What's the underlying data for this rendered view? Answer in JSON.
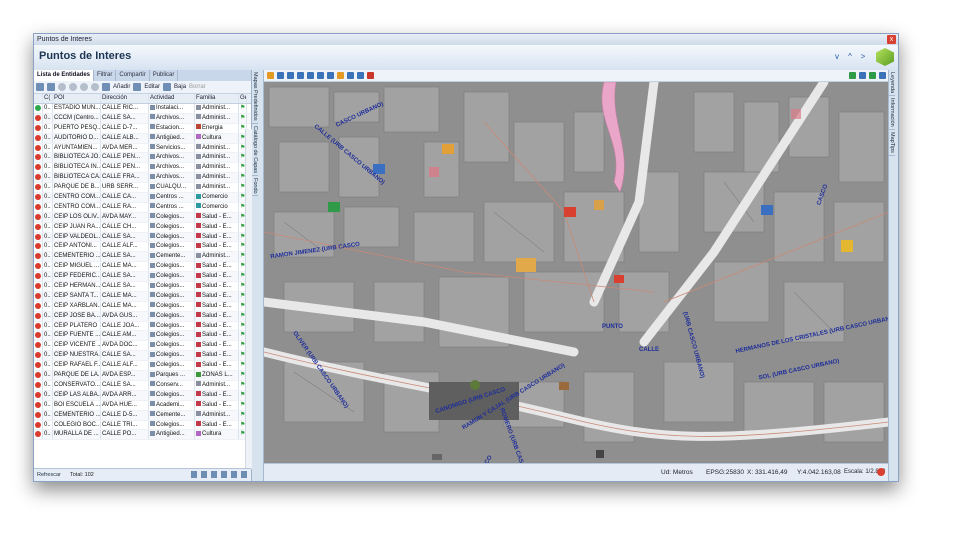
{
  "window": {
    "title": "Puntos de Interes",
    "header_title": "Puntos de Interes",
    "close": "x"
  },
  "header_buttons": [
    "v",
    "^",
    ">"
  ],
  "left_tabs": [
    "Lista de Entidades",
    "Filtrar",
    "Compartir",
    "Publicar"
  ],
  "left_toolbar": {
    "add": "Añadir",
    "edit": "Editar",
    "remove": "Baja",
    "delete": "Borrar"
  },
  "columns": {
    "c": "C(",
    "poi": "POI",
    "dir": "Dirección",
    "act": "Actividad",
    "fam": "Familia",
    "ge": "Ge"
  },
  "rows": [
    {
      "c": "0..",
      "poi": "ESTADIO MUN...",
      "dir": "CALLE RIC...",
      "act": "Instalaci...",
      "fam": "Administ...",
      "status": "green"
    },
    {
      "c": "0..",
      "poi": "CCCM (Centro...",
      "dir": "CALLE SA...",
      "act": "Archivos...",
      "fam": "Administ...",
      "status": "red"
    },
    {
      "c": "0..",
      "poi": "PUERTO PESQ...",
      "dir": "CALLE D-7...",
      "act": "Estacion...",
      "fam": "Energia",
      "status": "red"
    },
    {
      "c": "0..",
      "poi": "AUDITORIO D...",
      "dir": "CALLE ALB...",
      "act": "Antigüed...",
      "fam": "Cultura",
      "status": "red"
    },
    {
      "c": "0..",
      "poi": "AYUNTAMIEN...",
      "dir": "AVDA MER...",
      "act": "Servicios...",
      "fam": "Administ...",
      "status": "red"
    },
    {
      "c": "0..",
      "poi": "BIBLIOTECA JO...",
      "dir": "CALLE PEÑ...",
      "act": "Archivos...",
      "fam": "Administ...",
      "status": "red"
    },
    {
      "c": "0..",
      "poi": "BIBLIOTECA IN...",
      "dir": "CALLE PEÑ...",
      "act": "Archivos...",
      "fam": "Administ...",
      "status": "red"
    },
    {
      "c": "0..",
      "poi": "BIBLIOTECA CA...",
      "dir": "CALLE FRA...",
      "act": "Archivos...",
      "fam": "Administ...",
      "status": "red"
    },
    {
      "c": "0..",
      "poi": "PARQUE DE B...",
      "dir": "URB SERR...",
      "act": "CUALQU...",
      "fam": "Administ...",
      "status": "red"
    },
    {
      "c": "0..",
      "poi": "CENTRO COM...",
      "dir": "CALLE CA...",
      "act": "Centros ...",
      "fam": "Comercio",
      "status": "red"
    },
    {
      "c": "0..",
      "poi": "CENTRO COM...",
      "dir": "CALLE RA...",
      "act": "Centros ...",
      "fam": "Comercio",
      "status": "red"
    },
    {
      "c": "0..",
      "poi": "CEIP LOS OLIV...",
      "dir": "AVDA MAY...",
      "act": "Colegios...",
      "fam": "Salud - E...",
      "status": "red"
    },
    {
      "c": "0..",
      "poi": "CEIP JUAN RA...",
      "dir": "CALLE CH...",
      "act": "Colegios...",
      "fam": "Salud - E...",
      "status": "red"
    },
    {
      "c": "0..",
      "poi": "CEIP VALDEOL...",
      "dir": "CALLE SA...",
      "act": "Colegios...",
      "fam": "Salud - E...",
      "status": "red"
    },
    {
      "c": "0..",
      "poi": "CEIP ANTONI...",
      "dir": "CALLE ALF...",
      "act": "Colegios...",
      "fam": "Salud - E...",
      "status": "red"
    },
    {
      "c": "0..",
      "poi": "CEMENTERIO ...",
      "dir": "CALLE SA...",
      "act": "Cemente...",
      "fam": "Administ...",
      "status": "red"
    },
    {
      "c": "0..",
      "poi": "CEIP MIGUEL ...",
      "dir": "CALLE MA...",
      "act": "Colegios...",
      "fam": "Salud - E...",
      "status": "red"
    },
    {
      "c": "0..",
      "poi": "CEIP FEDERIC...",
      "dir": "CALLE SA...",
      "act": "Colegios...",
      "fam": "Salud - E...",
      "status": "red"
    },
    {
      "c": "0..",
      "poi": "CEIP HERMAN...",
      "dir": "CALLE SA...",
      "act": "Colegios...",
      "fam": "Salud - E...",
      "status": "red"
    },
    {
      "c": "0..",
      "poi": "CEIP SANTA T...",
      "dir": "CALLE MA...",
      "act": "Colegios...",
      "fam": "Salud - E...",
      "status": "red"
    },
    {
      "c": "0..",
      "poi": "CEIP XARBLAN...",
      "dir": "CALLE MA...",
      "act": "Colegios...",
      "fam": "Salud - E...",
      "status": "red"
    },
    {
      "c": "0..",
      "poi": "CEIP JOSE BA...",
      "dir": "AVDA GUS...",
      "act": "Colegios...",
      "fam": "Salud - E...",
      "status": "red"
    },
    {
      "c": "0..",
      "poi": "CEIP PLATERO",
      "dir": "CALLE JOA...",
      "act": "Colegios...",
      "fam": "Salud - E...",
      "status": "red"
    },
    {
      "c": "0..",
      "poi": "CEIP FUENTE ...",
      "dir": "CALLE AM...",
      "act": "Colegios...",
      "fam": "Salud - E...",
      "status": "red"
    },
    {
      "c": "0..",
      "poi": "CEIP VICENTE ...",
      "dir": "AVDA DOC...",
      "act": "Colegios...",
      "fam": "Salud - E...",
      "status": "red"
    },
    {
      "c": "0..",
      "poi": "CEIP NUESTRA...",
      "dir": "CALLE SA...",
      "act": "Colegios...",
      "fam": "Salud - E...",
      "status": "red"
    },
    {
      "c": "0..",
      "poi": "CEIP RAFAEL F...",
      "dir": "CALLE ALF...",
      "act": "Colegios...",
      "fam": "Salud - E...",
      "status": "red"
    },
    {
      "c": "0..",
      "poi": "PARQUE DE LA...",
      "dir": "AVDA ESP...",
      "act": "Parques ...",
      "fam": "ZONAS L...",
      "status": "red"
    },
    {
      "c": "0..",
      "poi": "CONSERVATO...",
      "dir": "CALLE SA...",
      "act": "Conserv...",
      "fam": "Administ...",
      "status": "red"
    },
    {
      "c": "0..",
      "poi": "CEIP LAS ALBA...",
      "dir": "AVDA ARR...",
      "act": "Colegios...",
      "fam": "Salud - E...",
      "status": "red"
    },
    {
      "c": "0..",
      "poi": "BOI ESCUELA ...",
      "dir": "AVDA HUE...",
      "act": "Academi...",
      "fam": "Salud - E...",
      "status": "red"
    },
    {
      "c": "0..",
      "poi": "CEMENTERIO ...",
      "dir": "CALLE D-5...",
      "act": "Cemente...",
      "fam": "Administ...",
      "status": "red"
    },
    {
      "c": "0..",
      "poi": "COLEGIO BOC...",
      "dir": "CALLE TRI...",
      "act": "Colegios...",
      "fam": "Salud - E...",
      "status": "red"
    },
    {
      "c": "0..",
      "poi": "MURALLA DE ...",
      "dir": "CALLE PO...",
      "act": "Antigüed...",
      "fam": "Cultura",
      "status": "red"
    }
  ],
  "left_status": {
    "refresh": "Refrescar",
    "total": "Total: 102"
  },
  "left_vertical_tabs": [
    "Mapas Predefinidos",
    "Catálogo de Capas",
    "Fondo"
  ],
  "right_vertical_tabs": [
    "Leyenda",
    "Información",
    "MapTips"
  ],
  "streets": [
    "RAMON JIMENEZ (URB CASCO",
    "RAMON Y CAJAL (URB CASCO URBANO)",
    "HERMANOS DE LOS CRISTALES (URB CASCO URBANO)",
    "SOL (URB CASCO URBANO)",
    "ANTONIO RELEN (URB CASCO",
    "OLIVER (URB CASCO URBANO)",
    "CANONIGO (URB CASCO",
    "(URB CASCO URBANO)",
    "CASCO URBANO)",
    "ROMERO (URB CASCO",
    "PUNTO",
    "CALLE",
    "CALLE (URB CASCO URBANO)",
    "CASCO"
  ],
  "map_status": {
    "units": "Ud: Metros",
    "epsg": "EPSG:25830",
    "x": "X: 331.416,49",
    "y": "Y:4.042.163,08",
    "scale": "Escala: 1/2.848"
  },
  "colors": {
    "accent": "#2657a3",
    "map_bg": "#8d8d8d",
    "street_label": "#1d2d9a",
    "status_red": "#d83a2b",
    "status_green": "#2fa84a"
  }
}
